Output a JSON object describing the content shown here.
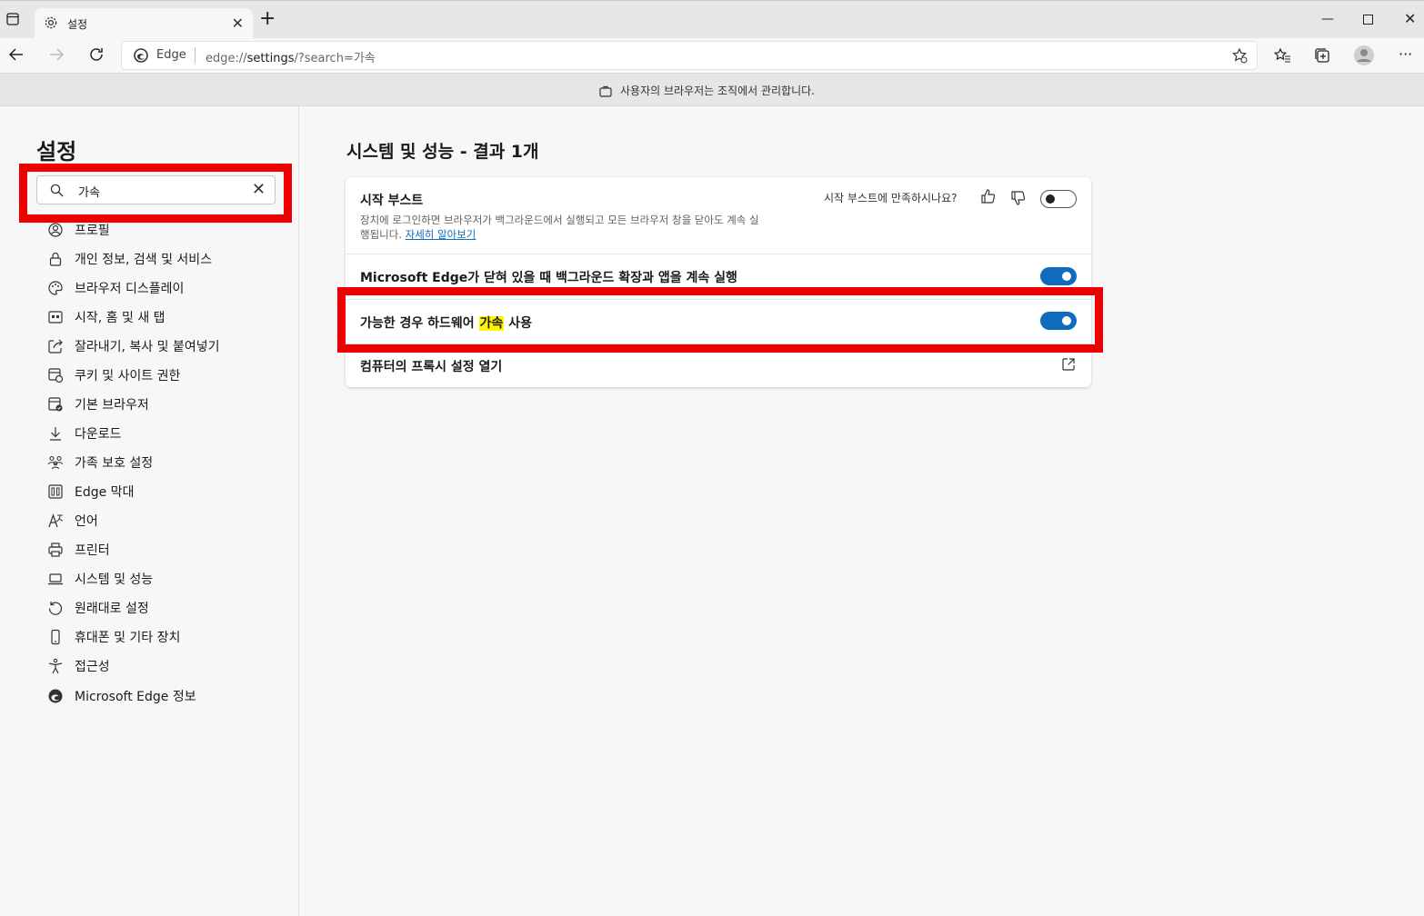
{
  "browser": {
    "tab_title": "설정",
    "brand": "Edge",
    "url_prefix": "edge://",
    "url_path": "settings",
    "url_query": "/?search=가속",
    "managed_notice": "사용자의 브라우저는 조직에서 관리합니다."
  },
  "sidebar": {
    "title": "설정",
    "search_value": "가속",
    "items": [
      {
        "label": "프로필",
        "icon": "profile-icon"
      },
      {
        "label": "개인 정보, 검색 및 서비스",
        "icon": "lock-icon"
      },
      {
        "label": "브라우저 디스플레이",
        "icon": "palette-icon"
      },
      {
        "label": "시작, 홈 및 새 탭",
        "icon": "start-icon"
      },
      {
        "label": "잘라내기, 복사 및 붙여넣기",
        "icon": "share-icon"
      },
      {
        "label": "쿠키 및 사이트 권한",
        "icon": "cookie-icon"
      },
      {
        "label": "기본 브라우저",
        "icon": "default-browser-icon"
      },
      {
        "label": "다운로드",
        "icon": "download-icon"
      },
      {
        "label": "가족 보호 설정",
        "icon": "family-icon"
      },
      {
        "label": "Edge 막대",
        "icon": "edge-bar-icon"
      },
      {
        "label": "언어",
        "icon": "language-icon"
      },
      {
        "label": "프린터",
        "icon": "printer-icon"
      },
      {
        "label": "시스템 및 성능",
        "icon": "laptop-icon"
      },
      {
        "label": "원래대로 설정",
        "icon": "reset-icon"
      },
      {
        "label": "휴대폰 및 기타 장치",
        "icon": "phone-icon"
      },
      {
        "label": "접근성",
        "icon": "accessibility-icon"
      },
      {
        "label": "Microsoft Edge 정보",
        "icon": "edge-logo-icon"
      }
    ]
  },
  "main": {
    "title": "시스템 및 성능 - 결과 1개",
    "startup_boost": {
      "label": "시작 부스트",
      "feedback": "시작 부스트에 만족하시나요?",
      "description": "장치에 로그인하면 브라우저가 백그라운드에서 실행되고 모든 브라우저 창을 닫아도 계속 실",
      "description2": "행됩니다.",
      "learn_more": "자세히 알아보기",
      "enabled": false
    },
    "background_apps": {
      "label": "Microsoft Edge가 닫혀 있을 때 백그라운드 확장과 앱을 계속 실행",
      "enabled": true
    },
    "hardware_accel": {
      "label_before": "가능한 경우 하드웨어 ",
      "label_highlight": "가속",
      "label_after": " 사용",
      "enabled": true
    },
    "proxy": {
      "label": "컴퓨터의 프록시 설정 열기"
    }
  },
  "colors": {
    "accent": "#0f6cbd",
    "highlight_box": "#ee0000",
    "search_highlight": "#fff500"
  }
}
